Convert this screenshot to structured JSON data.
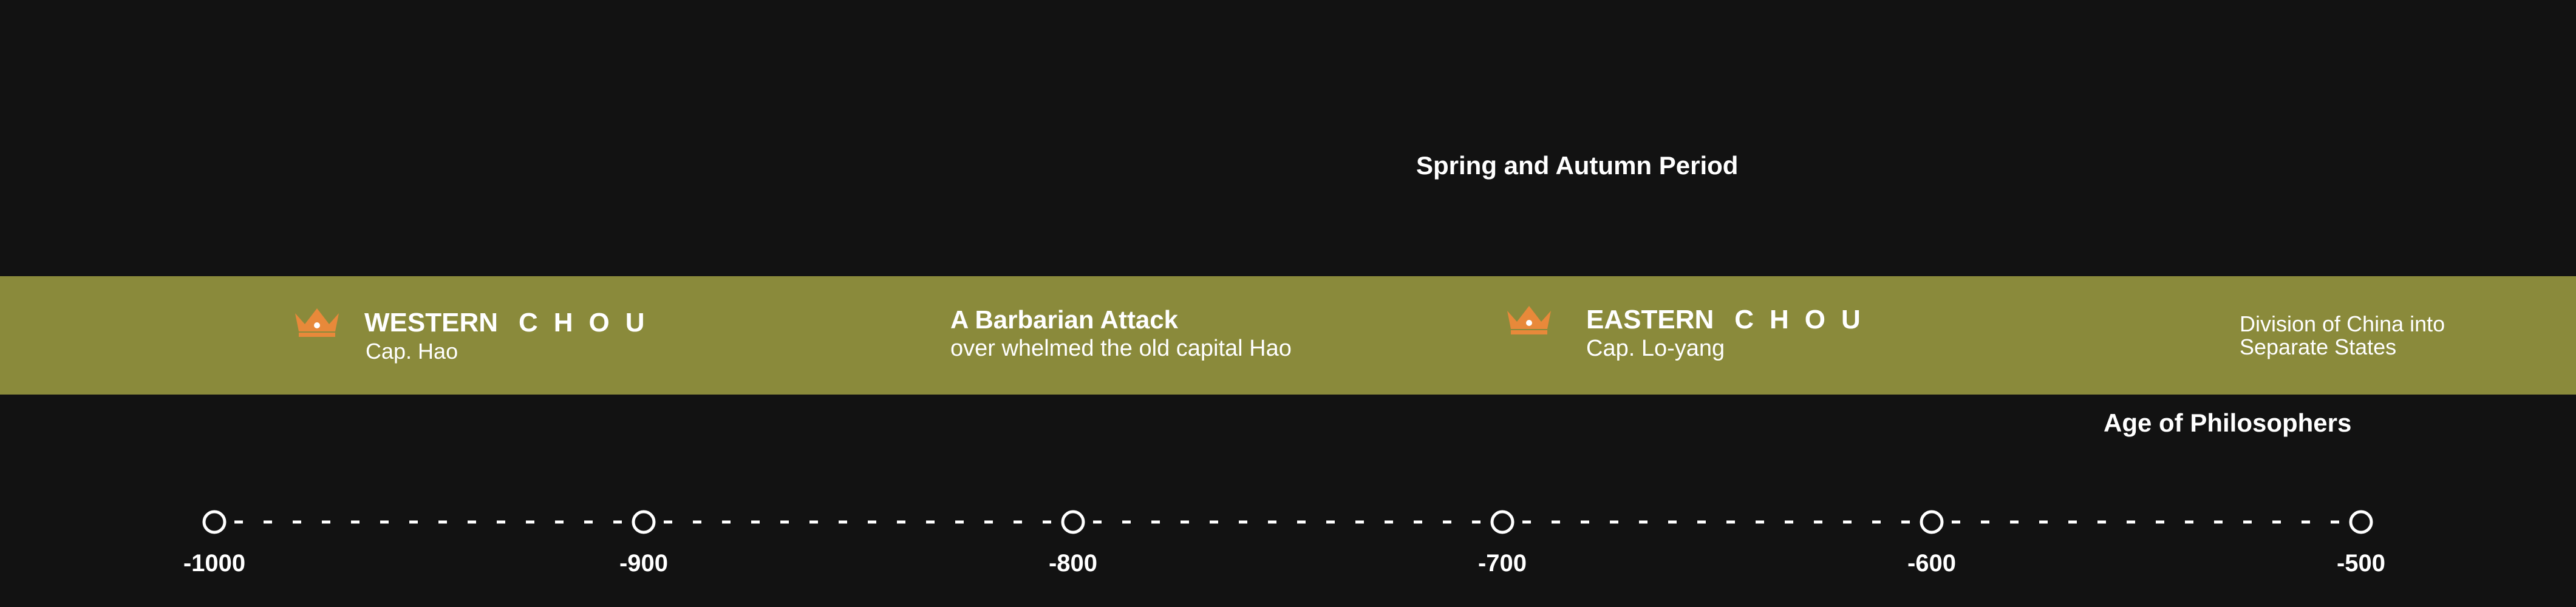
{
  "period_labels": {
    "spring_autumn": "Spring and Autumn Period",
    "philosophers": "Age of Philosophers"
  },
  "band": {
    "color": "#8a8a3b",
    "western": {
      "title_prefix": "WESTERN",
      "title_dynasty": "CHOU",
      "subtitle": "Cap. Hao",
      "icon": "crown-icon"
    },
    "barbarian": {
      "title": "A Barbarian Attack",
      "subtitle": "over whelmed the old capital Hao"
    },
    "eastern": {
      "title_prefix": "EASTERN",
      "title_dynasty": "CHOU",
      "subtitle": "Cap. Lo-yang",
      "icon": "crown-icon"
    },
    "division": {
      "line1": "Division of China into",
      "line2": "Separate States"
    }
  },
  "axis": {
    "ticks": [
      -1000,
      -900,
      -800,
      -700,
      -600,
      -500
    ],
    "tick_labels": [
      "-1000",
      "-900",
      "-800",
      "-700",
      "-600",
      "-500"
    ]
  },
  "colors": {
    "background": "#121212",
    "crown": "#e8893a",
    "text": "#ffffff"
  }
}
